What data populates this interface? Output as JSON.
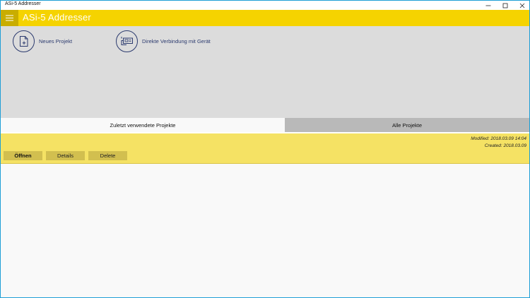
{
  "window": {
    "title": "ASi-5 Addresser",
    "controls": [
      "minimize-icon",
      "maximize-icon",
      "close-icon"
    ]
  },
  "app": {
    "title": "ASi-5 Addresser",
    "menu_icon": "hamburger-icon",
    "accent_color": "#f5d300"
  },
  "actions": {
    "new_project": {
      "label": "Neues Projekt",
      "icon": "new-document-icon"
    },
    "direct_connect": {
      "label": "Direkte Verbindung mit Gerät",
      "icon": "device-connection-icon"
    }
  },
  "tabs": [
    {
      "label": "Zuletzt verwendete Projekte",
      "selected": true
    },
    {
      "label": "Alle Projekte",
      "selected": false
    }
  ],
  "project": {
    "modified": "Modified: 2018.03.09 14:04",
    "created": "Created: 2018.03.09",
    "buttons": {
      "open": "Öffnen",
      "details": "Details",
      "delete": "Delete"
    }
  }
}
